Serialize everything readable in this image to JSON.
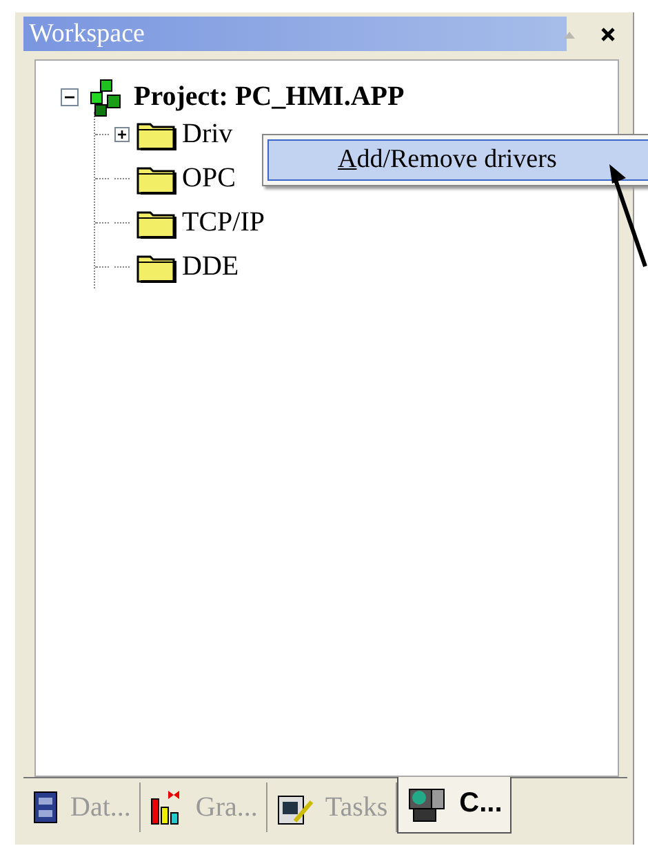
{
  "panel": {
    "title": "Workspace"
  },
  "tree": {
    "label": "Project: PC_HMI.APP",
    "expanded": true,
    "children": [
      {
        "label": "Driv",
        "expanded": false
      },
      {
        "label": "OPC"
      },
      {
        "label": "TCP/IP"
      },
      {
        "label": "DDE"
      }
    ]
  },
  "context_menu": {
    "items": [
      {
        "label": "**A**dd/Remove drivers",
        "selected": true
      }
    ]
  },
  "tabs": [
    {
      "label": "Dat...",
      "kind": "database",
      "selected": false
    },
    {
      "label": "Gra...",
      "kind": "graphics",
      "selected": false
    },
    {
      "label": "Tasks",
      "kind": "tasks",
      "selected": false
    },
    {
      "label": "C...",
      "kind": "comm",
      "selected": true
    }
  ]
}
